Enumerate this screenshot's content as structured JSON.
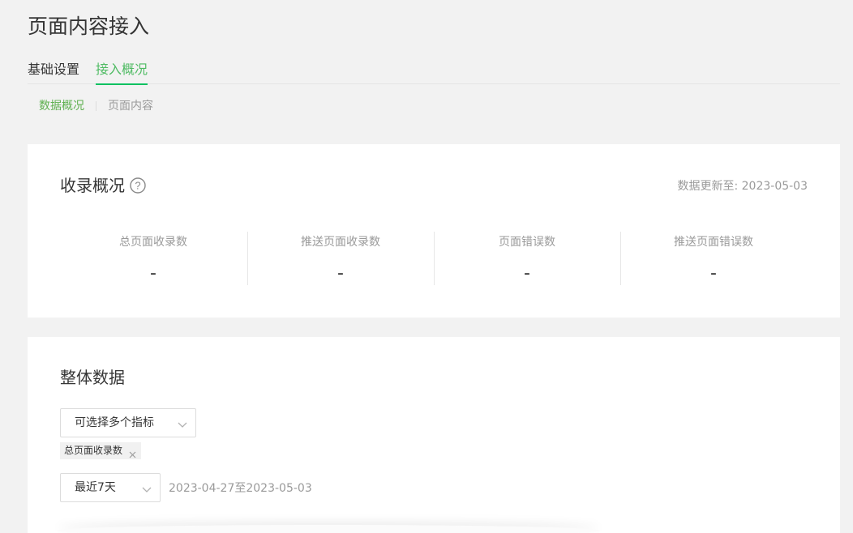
{
  "page": {
    "title": "页面内容接入"
  },
  "tabs": [
    {
      "label": "基础设置",
      "active": false
    },
    {
      "label": "接入概况",
      "active": true
    }
  ],
  "subtabs": [
    {
      "label": "数据概况",
      "active": true
    },
    {
      "label": "页面内容",
      "active": false
    }
  ],
  "overview": {
    "title": "收录概况",
    "help_icon": "question-circle-icon",
    "update_text": "数据更新至: 2023-05-03",
    "stats": [
      {
        "label": "总页面收录数",
        "value": "-"
      },
      {
        "label": "推送页面收录数",
        "value": "-"
      },
      {
        "label": "页面错误数",
        "value": "-"
      },
      {
        "label": "推送页面错误数",
        "value": "-"
      }
    ]
  },
  "overall": {
    "title": "整体数据",
    "metric_select": {
      "placeholder": "可选择多个指标"
    },
    "selected_tags": [
      "总页面收录数"
    ],
    "period_select": {
      "value": "最近7天"
    },
    "date_range": "2023-04-27至2023-05-03"
  },
  "colors": {
    "accent": "#4fbb63",
    "background": "#f2f2f2",
    "card": "#ffffff",
    "muted_text": "#9a9a9a"
  }
}
